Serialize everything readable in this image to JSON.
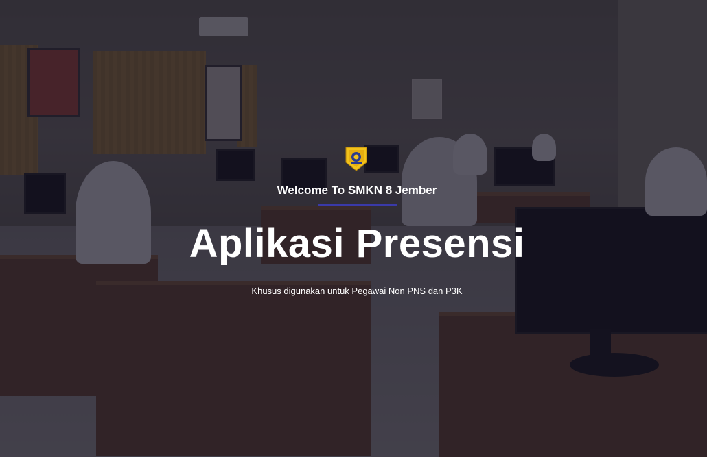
{
  "hero": {
    "welcome": "Welcome To SMKN 8 Jember",
    "title": "Aplikasi Presensi",
    "subtitle": "Khusus digunakan untuk Pegawai Non PNS dan P3K"
  },
  "colors": {
    "overlay": "#141223",
    "accent_divider": "#3a3aa8",
    "text": "#ffffff",
    "logo_gold": "#f2c21b"
  },
  "icons": {
    "logo": "school-crest-icon"
  }
}
